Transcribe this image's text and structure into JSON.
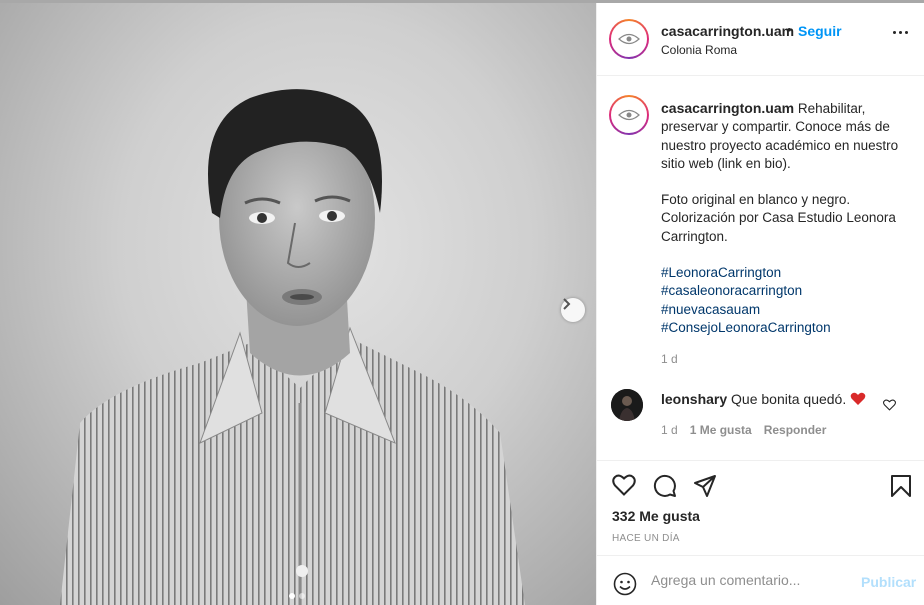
{
  "post": {
    "username": "casacarrington.uam",
    "follow_label": "Seguir",
    "follow_separator": "•",
    "location": "Colonia Roma",
    "caption_text": "Rehabilitar, preservar y compartir. Conoce más de nuestro proyecto académico en nuestro sitio web (link en bio).",
    "caption_paragraph2": "Foto original en blanco y negro. Colorización por Casa Estudio Leonora Carrington.",
    "hashtags": [
      "#LeonoraCarrington",
      "#casaleonoracarrington",
      "#nuevacasauam",
      "#ConsejoLeonoraCarrington"
    ],
    "age": "1 d",
    "likes": "332 Me gusta",
    "posted": "HACE UN DÍA"
  },
  "comment": {
    "username": "leonshary",
    "text": "Que bonita quedó.",
    "age": "1 d",
    "likes": "1 Me gusta",
    "reply_label": "Responder"
  },
  "comment_box": {
    "placeholder": "Agrega un comentario...",
    "publish_label": "Publicar"
  },
  "carousel": {
    "slides": 2,
    "active": 0
  },
  "colors": {
    "accent": "#0095f6",
    "link": "#00376b",
    "muted": "#8e8e8e",
    "publish_disabled": "#b2dffc",
    "heart": "#ed4956"
  },
  "icons": [
    "eye-logo-icon",
    "more-icon",
    "heart-icon",
    "comment-icon",
    "share-icon",
    "bookmark-icon",
    "emoji-icon",
    "chevron-right-icon"
  ]
}
